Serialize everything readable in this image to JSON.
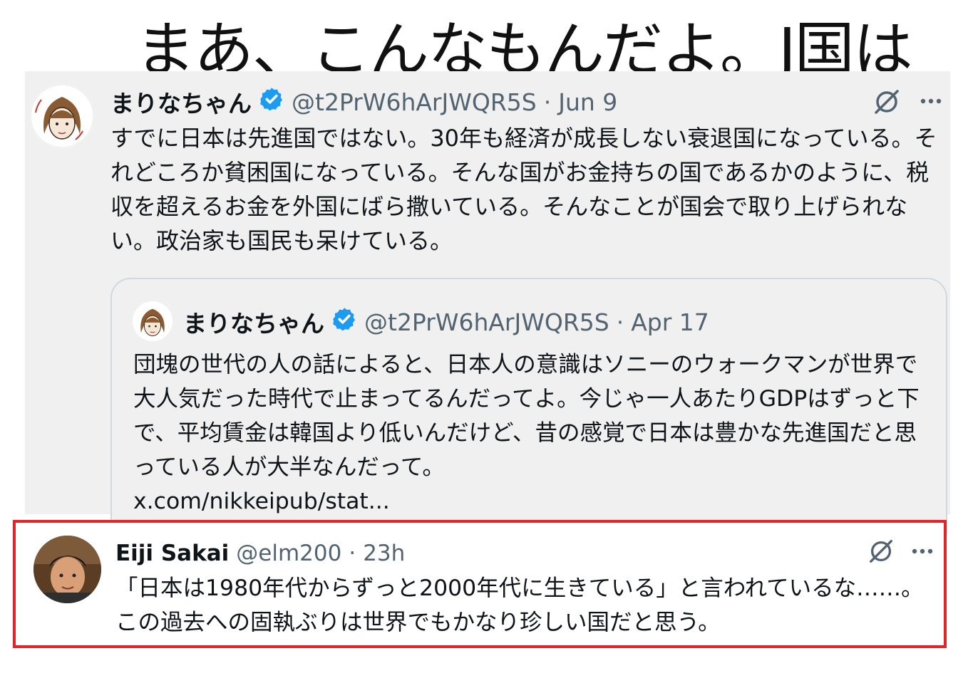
{
  "headline": "まあ、こんなもんだよ。J国は",
  "main_tweet": {
    "name": "まりなちゃん",
    "handle": "@t2PrW6hArJWQR5S",
    "separator": "·",
    "date": "Jun 9",
    "text": "すでに日本は先進国ではない。30年も経済が成長しない衰退国になっている。それどころか貧困国になっている。そんな国がお金持ちの国であるかのように、税収を超えるお金を外国にばら撒いている。そんなことが国会で取り上げられない。政治家も国民も呆けている。",
    "more_icon": "more-horizontal-icon",
    "grok_icon": "grok-icon"
  },
  "quote_tweet": {
    "name": "まりなちゃん",
    "handle": "@t2PrW6hArJWQR5S",
    "separator": "·",
    "date": "Apr 17",
    "text": "団塊の世代の人の話によると、日本人の意識はソニーのウォークマンが世界で大人気だった時代で止まってるんだってよ。今じゃ一人あたりGDPはずっと下で、平均賃金は韓国より低いんだけど、昔の感覚で日本は豊かな先進国だと思っている人が大半なんだって。",
    "link": "x.com/nikkeipub/stat..."
  },
  "reply_tweet": {
    "name": "Eiji Sakai",
    "handle": "@elm200",
    "separator": "·",
    "time": "23h",
    "text": "「日本は1980年代からずっと2000年代に生きている」と言われているな……。この過去への固執ぶりは世界でもかなり珍しい国だと思う。",
    "more_icon": "more-horizontal-icon",
    "grok_icon": "grok-icon"
  },
  "colors": {
    "verified_badge": "#1d9bf0",
    "highlight_border": "#e3252a",
    "panel_background": "#f0f0f1",
    "meta_text": "#536471"
  }
}
